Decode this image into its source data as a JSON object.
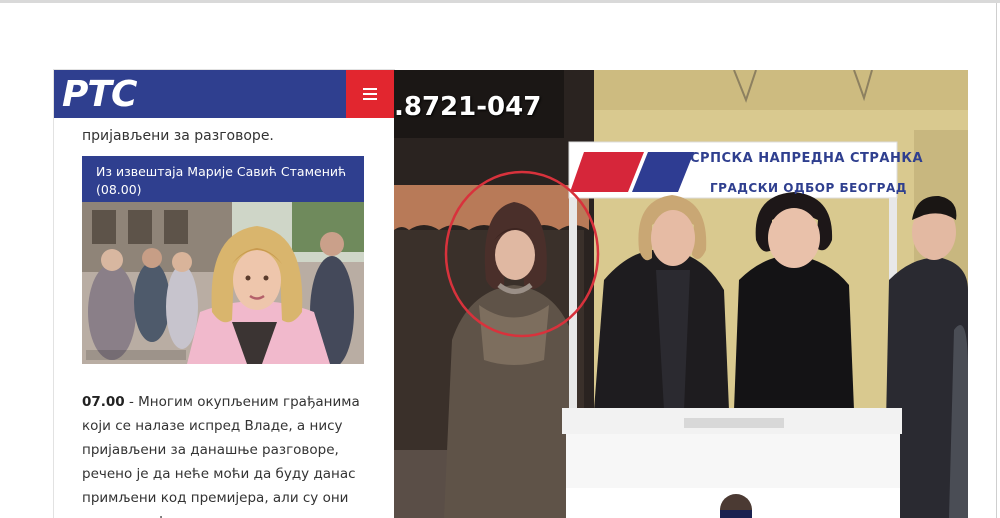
{
  "rts": {
    "logo": "РТС",
    "intro": "пријављени за разговоре.",
    "caption": {
      "line1": "Из извештаја Марије Савић Стаменић",
      "line2": "(08.00)"
    },
    "body": {
      "time": "07.00",
      "line1_rest": " - Многим окупљеним грађанима",
      "line2": "који се налазе испред Владе, а нису",
      "line3": "пријављени за данашње разговоре,",
      "line4": "речено је да неће моћи да буду данас",
      "line5": "примљени код премијера, али су они",
      "line6": "попунили формуларе."
    }
  },
  "photo": {
    "phone_sign": ".8721-047",
    "banner_line1": "СРПСКА НАПРЕДНА СТРАНКА",
    "banner_line2": "ГРАДСКИ ОДБОР БЕОГРАД"
  },
  "colors": {
    "rts_blue": "#2f3f8f",
    "rts_red": "#e2262f",
    "highlight_circle": "#d8323c"
  }
}
